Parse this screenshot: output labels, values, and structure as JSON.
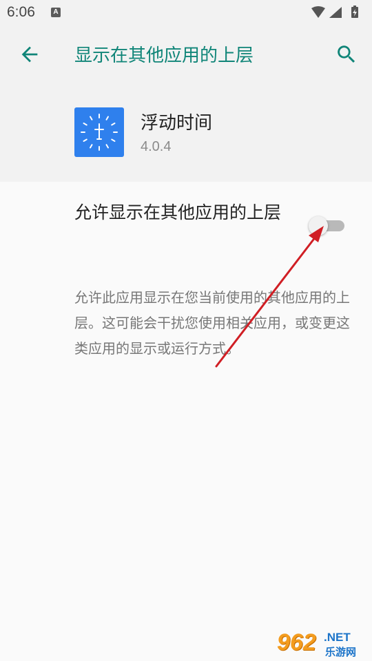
{
  "status_bar": {
    "time": "6:06",
    "notification_badge": "A",
    "icons": [
      "wifi-icon",
      "signal-icon",
      "battery-charging-icon"
    ]
  },
  "header": {
    "title": "显示在其他应用的上层",
    "back_icon": "arrow-left-icon",
    "search_icon": "search-icon"
  },
  "app": {
    "name": "浮动时间",
    "version": "4.0.4",
    "icon": "clock-icon",
    "icon_color": "#2f80ed"
  },
  "setting": {
    "label": "允许显示在其他应用的上层",
    "enabled": false
  },
  "description": "允许此应用显示在您当前使用的其他应用的上层。这可能会干扰您使用相关应用，或变更这类应用的显示或运行方式。",
  "colors": {
    "accent": "#108578",
    "annotation_arrow": "#d01e24"
  },
  "watermark": {
    "number": "962",
    "domain": ".NET",
    "chinese": "乐游网"
  }
}
